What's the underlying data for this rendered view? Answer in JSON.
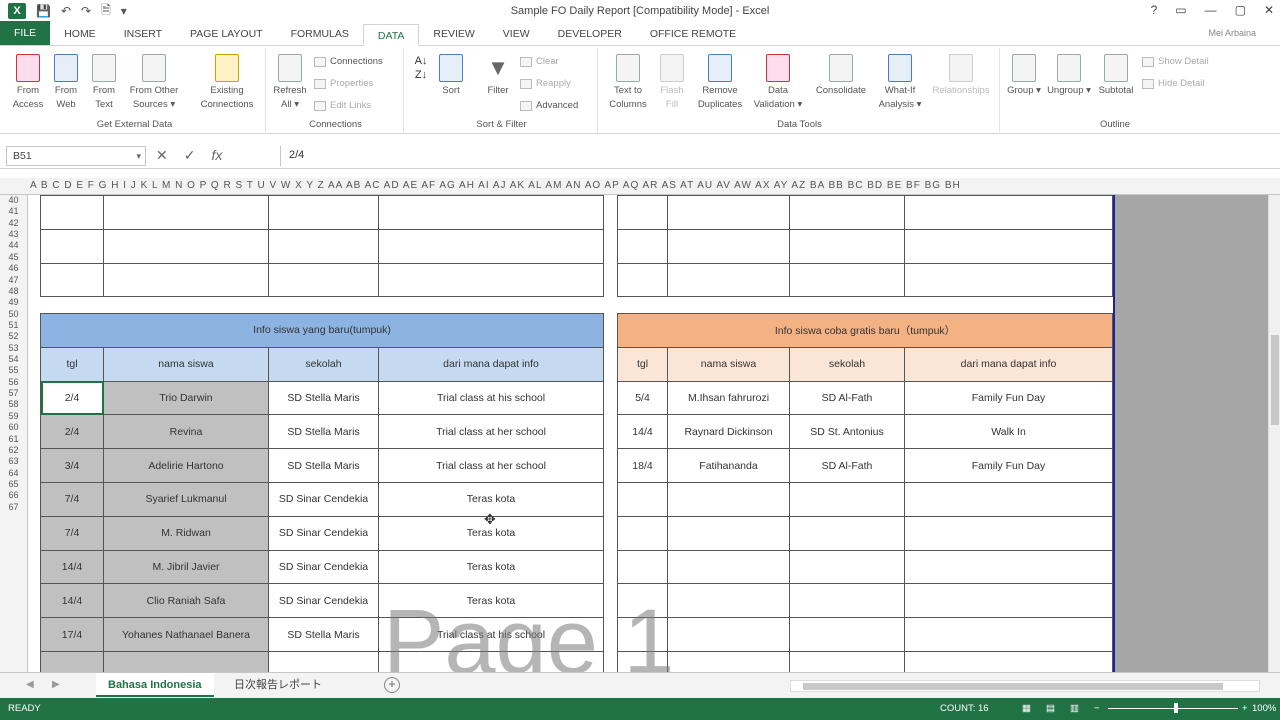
{
  "window": {
    "title": "Sample FO Daily Report  [Compatibility Mode] - Excel",
    "user": "Mei Arbaina",
    "buttons": [
      "?",
      "▭",
      "—",
      "▢",
      "✕"
    ]
  },
  "ribbon_tabs": [
    "FILE",
    "HOME",
    "INSERT",
    "PAGE LAYOUT",
    "FORMULAS",
    "DATA",
    "REVIEW",
    "VIEW",
    "DEVELOPER",
    "OFFICE REMOTE"
  ],
  "active_tab": "DATA",
  "ribbon": {
    "get_external": {
      "label": "Get External Data",
      "from_access": "From Access",
      "from_web": "From Web",
      "from_text": "From Text",
      "from_other": "From Other Sources ▾",
      "existing": "Existing Connections"
    },
    "connections": {
      "label": "Connections",
      "refresh": "Refresh All ▾",
      "connections": "Connections",
      "properties": "Properties",
      "edit_links": "Edit Links"
    },
    "sort_filter": {
      "label": "Sort & Filter",
      "sort": "Sort",
      "filter": "Filter",
      "clear": "Clear",
      "reapply": "Reapply",
      "advanced": "Advanced"
    },
    "data_tools": {
      "label": "Data Tools",
      "text_to_columns": "Text to Columns",
      "flash_fill": "Flash Fill",
      "remove_duplicates": "Remove Duplicates",
      "data_validation": "Data Validation ▾",
      "consolidate": "Consolidate",
      "what_if": "What-If Analysis ▾",
      "relationships": "Relationships"
    },
    "outline": {
      "label": "Outline",
      "group": "Group ▾",
      "ungroup": "Ungroup ▾",
      "subtotal": "Subtotal",
      "show_detail": "Show Detail",
      "hide_detail": "Hide Detail"
    }
  },
  "formula_bar": {
    "name_box": "B51",
    "formula": "2/4"
  },
  "column_headers": "A B C D E F G H I J K L M N O P Q R S T U V W X Y Z AA AB AC AD AE AF AG AH AI AJ AK AL AM AN AO AP AQ AR AS AT AU AV AW AX AY AZ BA BB BC BD BE BF BG BH",
  "rows": [
    "40",
    "41",
    "42",
    "43",
    "44",
    "45",
    "46",
    "47",
    "48",
    "49",
    "50",
    "51",
    "52",
    "53",
    "54",
    "55",
    "56",
    "57",
    "58",
    "59",
    "60",
    "61",
    "62",
    "63",
    "64",
    "65",
    "66",
    "67"
  ],
  "left_table": {
    "title": "Info siswa yang baru(tumpuk)",
    "headers": [
      "tgl",
      "nama siswa",
      "sekolah",
      "dari mana dapat info"
    ],
    "rows": [
      [
        "2/4",
        "Trio Darwin",
        "SD Stella Maris",
        "Trial class at his school"
      ],
      [
        "2/4",
        "Revina",
        "SD Stella Maris",
        "Trial class at her school"
      ],
      [
        "3/4",
        "Adelirie Hartono",
        "SD Stella Maris",
        "Trial class at her school"
      ],
      [
        "7/4",
        "Syarief Lukmanul",
        "SD Sinar Cendekia",
        "Teras kota"
      ],
      [
        "7/4",
        "M. Ridwan",
        "SD Sinar Cendekia",
        "Teras kota"
      ],
      [
        "14/4",
        "M. Jibril Javier",
        "SD Sinar Cendekia",
        "Teras kota"
      ],
      [
        "14/4",
        "Clio Raniah Safa",
        "SD Sinar Cendekia",
        "Teras kota"
      ],
      [
        "17/4",
        "Yohanes Nathanael Banera",
        "SD Stella Maris",
        "Trial class at his school"
      ]
    ]
  },
  "right_table": {
    "title": "Info siswa coba gratis baru（tumpuk）",
    "headers": [
      "tgl",
      "nama siswa",
      "sekolah",
      "dari mana dapat info"
    ],
    "rows": [
      [
        "5/4",
        "M.Ihsan fahrurozi",
        "SD Al-Fath",
        "Family Fun Day"
      ],
      [
        "14/4",
        "Raynard Dickinson",
        "SD St. Antonius",
        "Walk In"
      ],
      [
        "18/4",
        "Fatihananda",
        "SD Al-Fath",
        "Family Fun Day"
      ],
      [
        "",
        "",
        "",
        ""
      ],
      [
        "",
        "",
        "",
        ""
      ],
      [
        "",
        "",
        "",
        ""
      ],
      [
        "",
        "",
        "",
        ""
      ],
      [
        "",
        "",
        "",
        ""
      ]
    ]
  },
  "watermark": "Page 1",
  "sheet_tabs": [
    "Bahasa Indonesia",
    "日次報告レポート"
  ],
  "active_sheet": "Bahasa Indonesia",
  "status": {
    "mode": "READY",
    "count": "COUNT: 16",
    "zoom": "100%"
  }
}
